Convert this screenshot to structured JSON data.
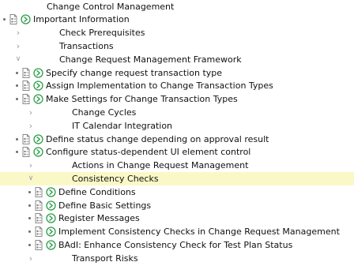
{
  "tree": {
    "items": [
      {
        "label": "Change Control Management",
        "level": 0,
        "type": "folder",
        "expander": "none"
      },
      {
        "label": "Important Information",
        "level": 0,
        "type": "activity",
        "expander": "none"
      },
      {
        "label": "Check Prerequisites",
        "level": 1,
        "type": "folder",
        "expander": "collapsed"
      },
      {
        "label": "Transactions",
        "level": 1,
        "type": "folder",
        "expander": "collapsed"
      },
      {
        "label": "Change Request Management Framework",
        "level": 1,
        "type": "folder",
        "expander": "expanded"
      },
      {
        "label": "Specify change request transaction type",
        "level": 1,
        "type": "activity",
        "expander": "none"
      },
      {
        "label": "Assign Implementation to Change Transaction Types",
        "level": 1,
        "type": "activity",
        "expander": "none"
      },
      {
        "label": "Make Settings for Change Transaction Types",
        "level": 1,
        "type": "activity",
        "expander": "none"
      },
      {
        "label": "Change Cycles",
        "level": 2,
        "type": "folder",
        "expander": "collapsed"
      },
      {
        "label": "IT Calendar Integration",
        "level": 2,
        "type": "folder",
        "expander": "collapsed"
      },
      {
        "label": "Define status change depending on approval result",
        "level": 1,
        "type": "activity",
        "expander": "none"
      },
      {
        "label": "Configure status-dependent UI element control",
        "level": 1,
        "type": "activity",
        "expander": "none"
      },
      {
        "label": "Actions in Change Request Management",
        "level": 2,
        "type": "folder",
        "expander": "collapsed"
      },
      {
        "label": "Consistency Checks",
        "level": 2,
        "type": "folder",
        "expander": "expanded",
        "selected": true
      },
      {
        "label": "Define Conditions",
        "level": 2,
        "type": "activity",
        "expander": "none"
      },
      {
        "label": "Define Basic Settings",
        "level": 2,
        "type": "activity",
        "expander": "none"
      },
      {
        "label": "Register Messages",
        "level": 2,
        "type": "activity",
        "expander": "none"
      },
      {
        "label": "Implement Consistency Checks in Change Request Management",
        "level": 2,
        "type": "activity",
        "expander": "none"
      },
      {
        "label": "BAdI: Enhance Consistency Check for Test Plan Status",
        "level": 2,
        "type": "activity",
        "expander": "none"
      },
      {
        "label": "Transport Risks",
        "level": 2,
        "type": "folder",
        "expander": "collapsed"
      }
    ]
  },
  "icons": {
    "activity_doc": "documentation-icon",
    "activity_exec": "execute-activity-icon",
    "collapsed": "chevron-right-icon",
    "expanded": "chevron-down-icon"
  },
  "colors": {
    "selected_background": "#fbf8c7",
    "execute_icon": "#2e9f4a",
    "text": "#111111"
  }
}
